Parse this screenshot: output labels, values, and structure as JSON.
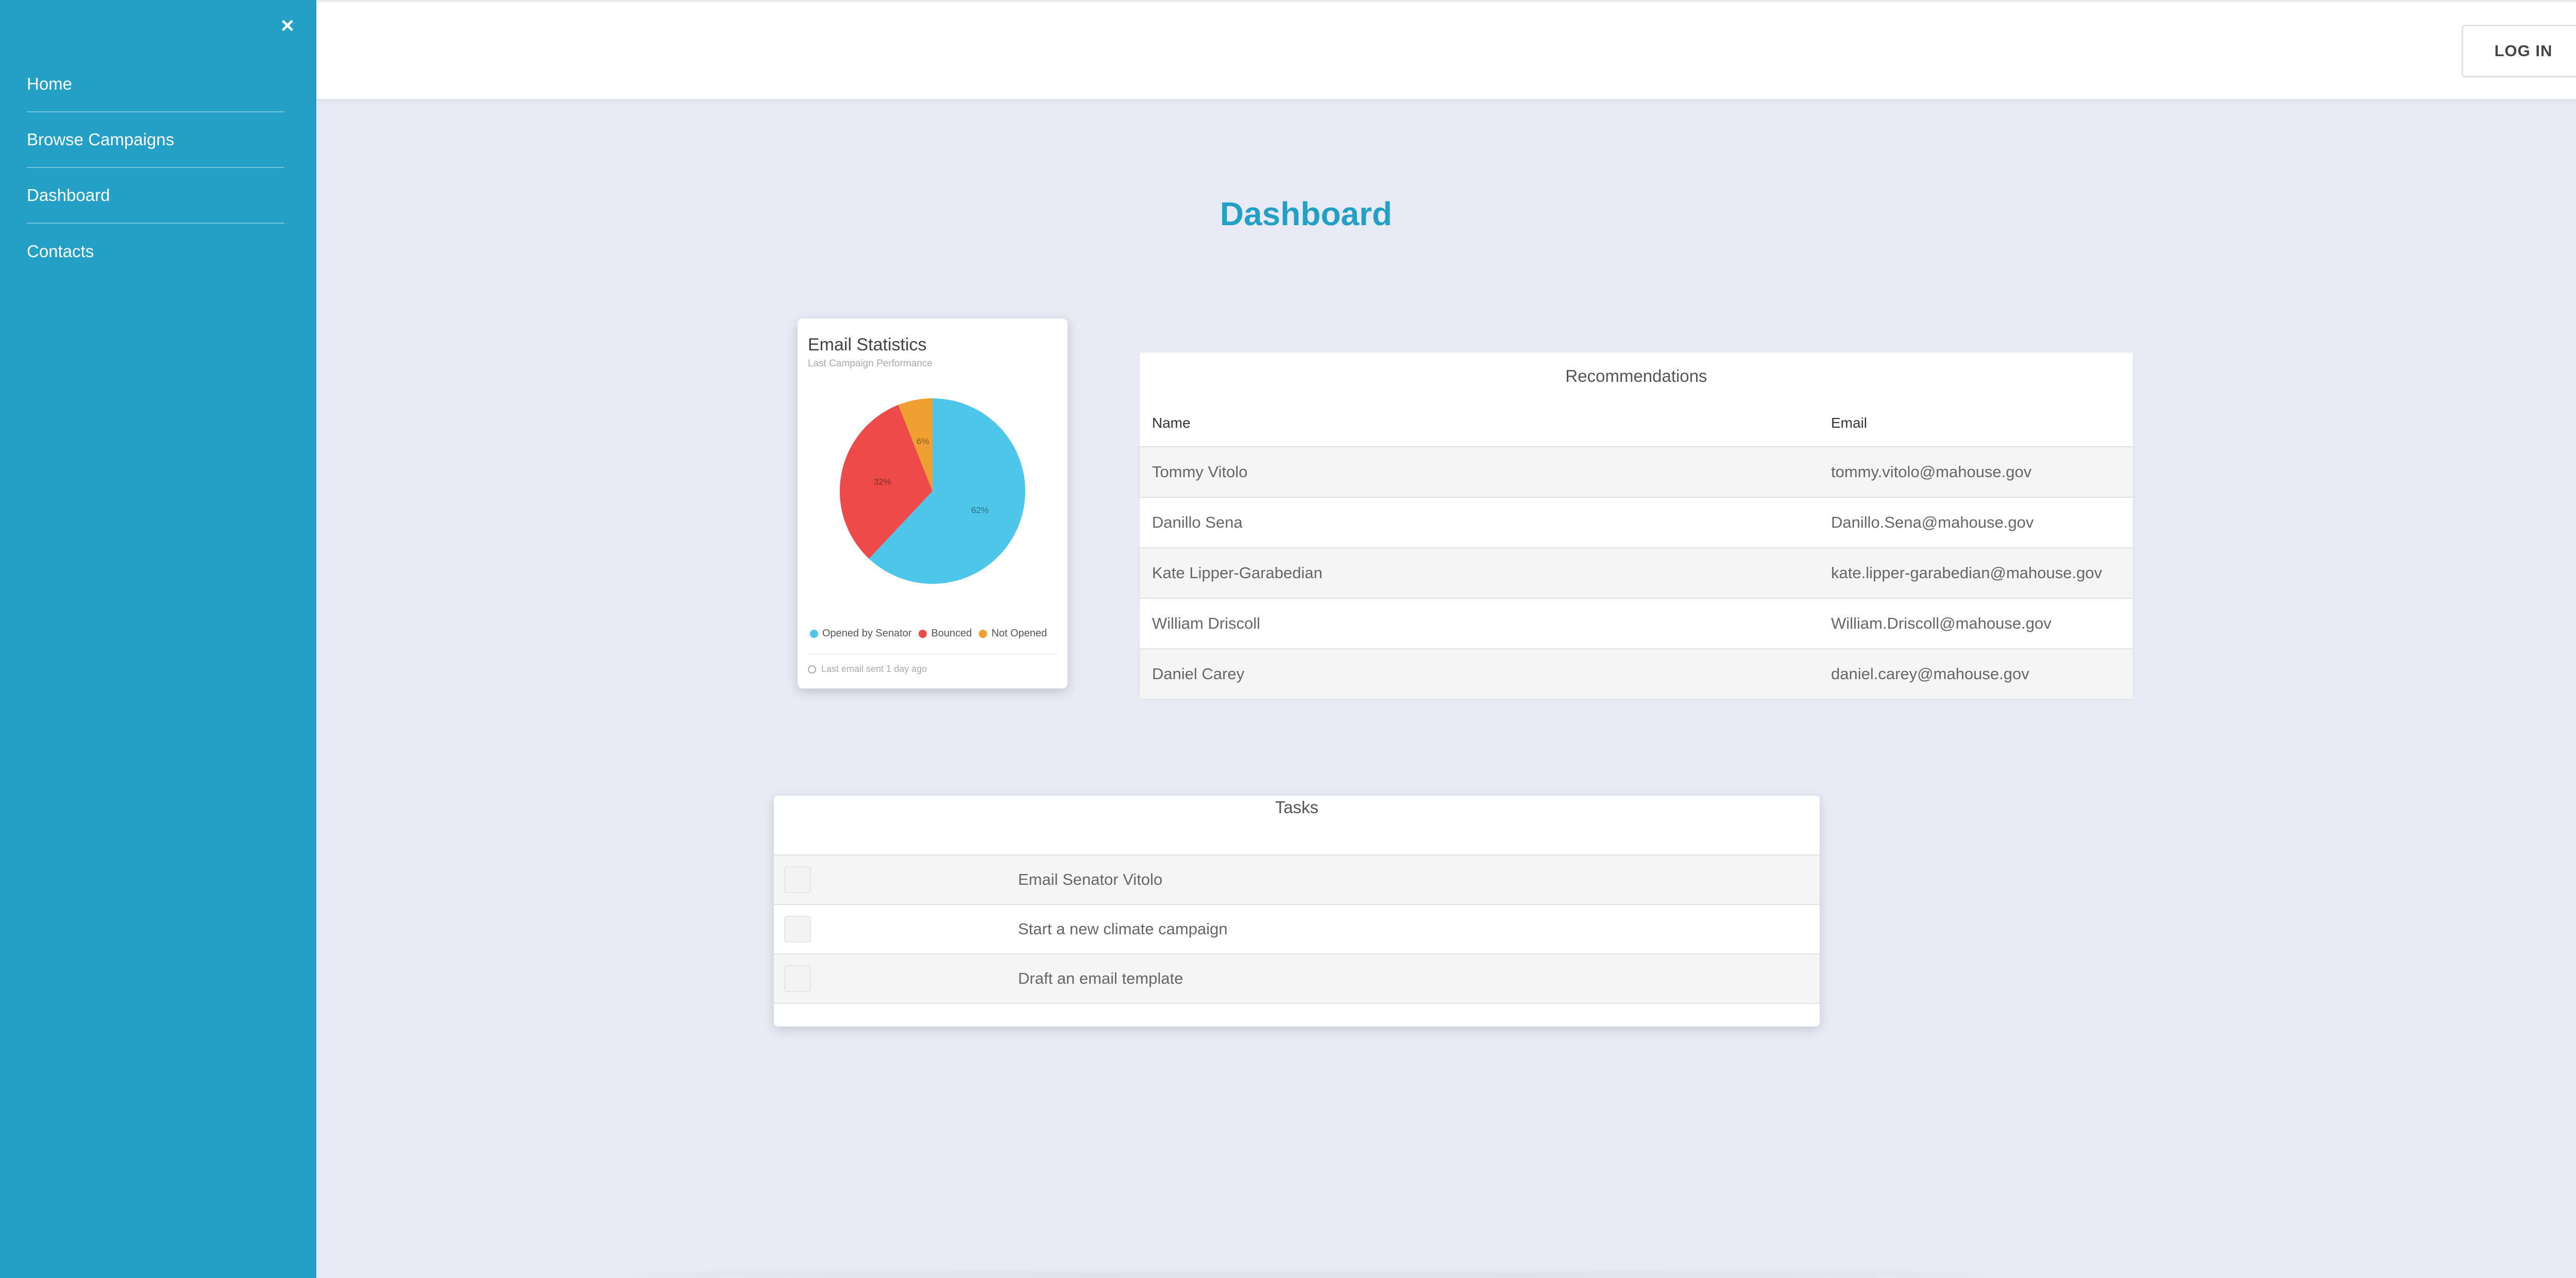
{
  "sidebar": {
    "close_icon": "×",
    "items": [
      {
        "label": "Home"
      },
      {
        "label": "Browse Campaigns"
      },
      {
        "label": "Dashboard"
      },
      {
        "label": "Contacts"
      }
    ],
    "bg_color": "#24a0c6"
  },
  "header": {
    "login_label": "LOG IN"
  },
  "page": {
    "title": "Dashboard",
    "accent_color": "#24a0c6",
    "background_color": "#e8eaf6"
  },
  "stats_card": {
    "title": "Email Statistics",
    "subtitle": "Last Campaign Performance",
    "footer": "Last email sent 1 day ago",
    "footer_icon": "clock-icon"
  },
  "chart_data": {
    "type": "pie",
    "title": "Email Statistics",
    "subtitle": "Last Campaign Performance",
    "categories": [
      "Opened by Senator",
      "Bounced",
      "Not Opened"
    ],
    "values": [
      62,
      32,
      6
    ],
    "labels": [
      "62%",
      "32%",
      "6%"
    ],
    "colors": [
      "#4ec6ea",
      "#ee4a4a",
      "#f0a030"
    ],
    "legend_position": "bottom"
  },
  "recommendations": {
    "title": "Recommendations",
    "columns": [
      "Name",
      "Email"
    ],
    "rows": [
      {
        "name": "Tommy Vitolo",
        "email": "tommy.vitolo@mahouse.gov"
      },
      {
        "name": "Danillo Sena",
        "email": "Danillo.Sena@mahouse.gov"
      },
      {
        "name": "Kate Lipper-Garabedian",
        "email": "kate.lipper-garabedian@mahouse.gov"
      },
      {
        "name": "William Driscoll",
        "email": "William.Driscoll@mahouse.gov"
      },
      {
        "name": "Daniel Carey",
        "email": "daniel.carey@mahouse.gov"
      }
    ]
  },
  "tasks": {
    "title": "Tasks",
    "items": [
      {
        "label": "Email Senator Vitolo",
        "checked": false
      },
      {
        "label": "Start a new climate campaign",
        "checked": false
      },
      {
        "label": "Draft an email template",
        "checked": false
      }
    ]
  }
}
